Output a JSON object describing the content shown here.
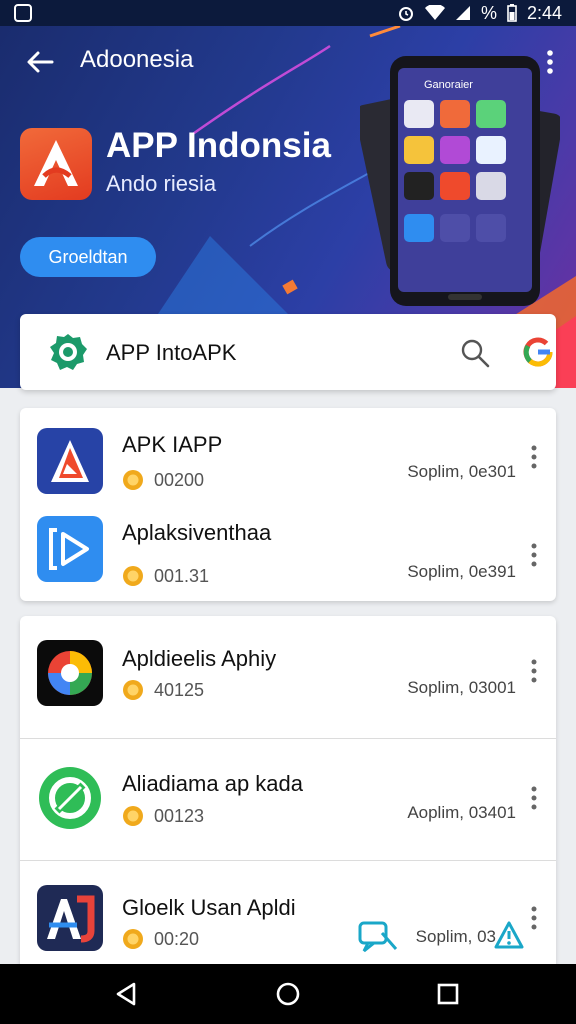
{
  "status_bar": {
    "time": "2:44",
    "battery_text": "%"
  },
  "header": {
    "title": "Adoonesia",
    "app_name": "APP Indonsia",
    "app_subtitle": "Ando riesia",
    "cta_label": "Groeldtan",
    "phone_header": "Ganoraier"
  },
  "search": {
    "text": "APP IntoAPK"
  },
  "apps": [
    {
      "name": "APK IAPP",
      "count": "00200",
      "date": "Soplim, 0e301",
      "icon": "apk-triangle-icon"
    },
    {
      "name": "Aplaksiventhaa",
      "count": "001.31",
      "date": "Soplim, 0e391",
      "icon": "bracket-play-icon"
    },
    {
      "name": "Apldieelis Aphiy",
      "count": "40125",
      "date": "Soplim, 03001",
      "icon": "color-ring-icon"
    },
    {
      "name": "Aliadiama ap kada",
      "count": "00123",
      "date": "Aoplim, 03401",
      "icon": "green-sync-icon"
    },
    {
      "name": "Gloelk Usan Apldi",
      "count": "00:20",
      "date": "Soplim, 03",
      "icon": "aj-logo-icon"
    }
  ],
  "colors": {
    "hero_dark": "#1a2c6e",
    "accent_blue": "#2f8df0",
    "logo_orange": "#e33b20",
    "coin_gold": "#f0a91c"
  }
}
